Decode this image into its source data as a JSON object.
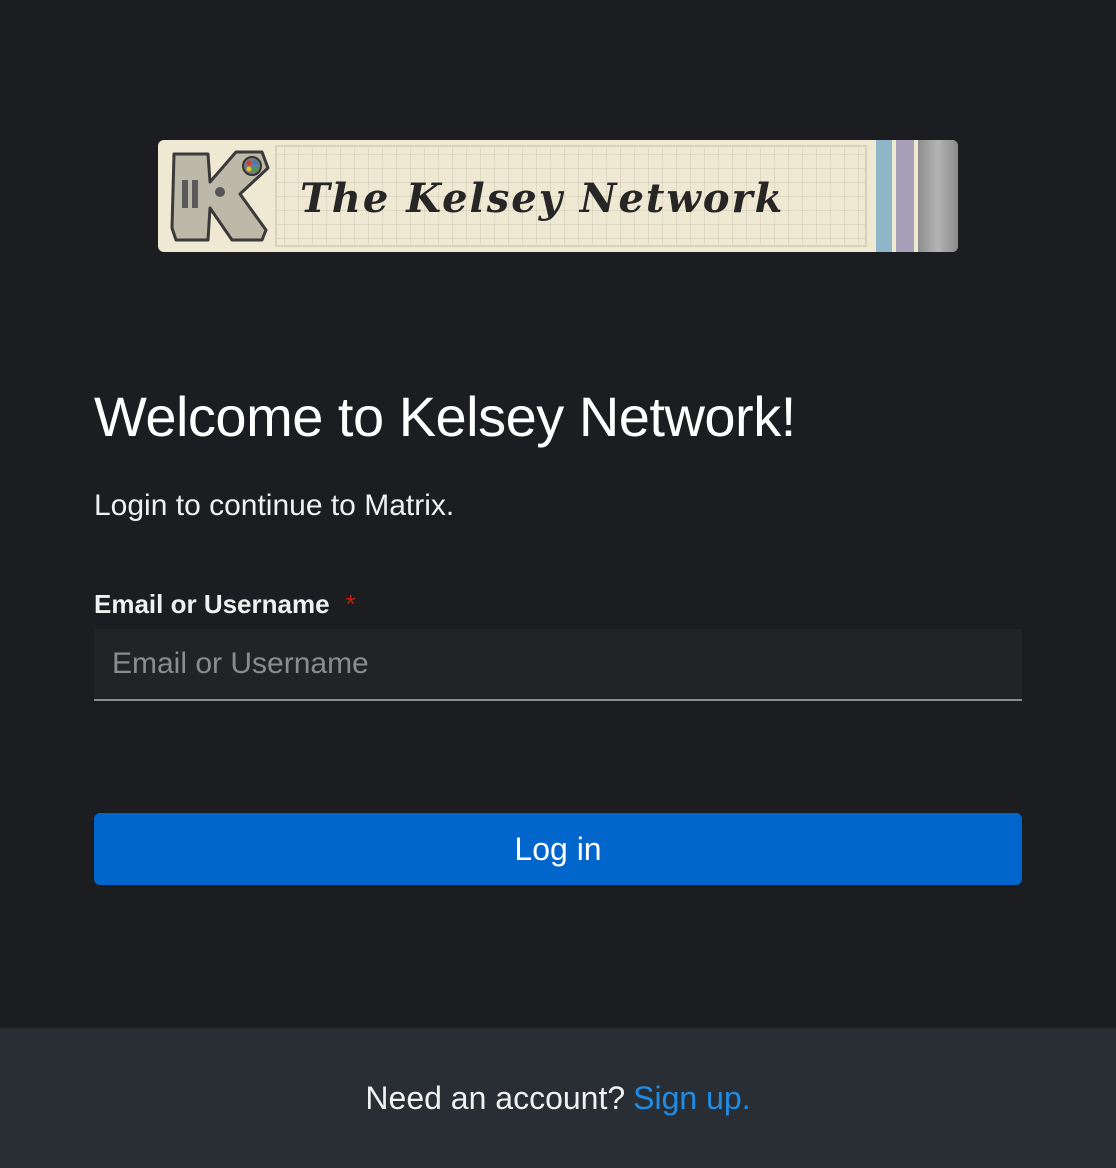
{
  "logo": {
    "text": "The Kelsey Network",
    "icon": "controller-k-logo-icon",
    "colors": {
      "paper": "#efe9d4",
      "grid": "#c9c3ad",
      "ink": "#2a2a2a",
      "stripe_blue": "#8fb5c9",
      "stripe_purple": "#a79fb8",
      "metal": "#9a9a9a"
    }
  },
  "heading": "Welcome to Kelsey Network!",
  "subtitle": "Login to continue to Matrix.",
  "form": {
    "username_label": "Email or Username",
    "required_marker": "*",
    "username_placeholder": "Email or Username",
    "username_value": "",
    "submit_label": "Log in"
  },
  "footer": {
    "prompt": "Need an account?",
    "signup_link": "Sign up."
  },
  "colors": {
    "background": "#1b1d21",
    "footer_background": "#292e34",
    "primary": "#0066cc",
    "link": "#1f8ce6",
    "required": "#c9190b"
  }
}
